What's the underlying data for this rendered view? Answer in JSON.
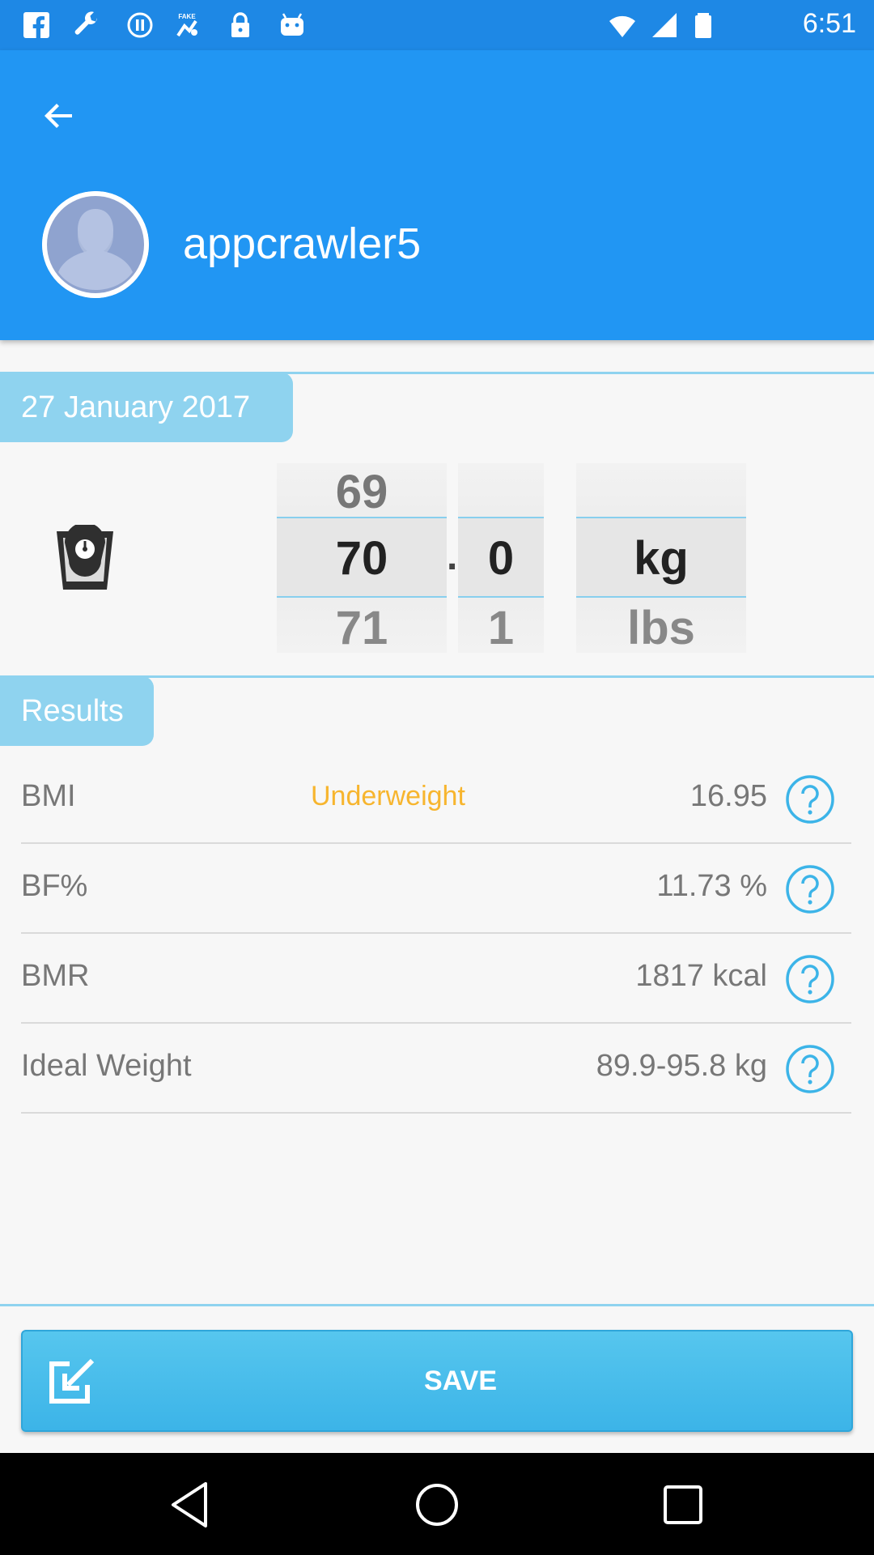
{
  "status_bar": {
    "time": "6:51",
    "left_icons": [
      "facebook-icon",
      "wrench-icon",
      "media-pause-icon",
      "fake-gps-icon",
      "lock-icon",
      "android-icon"
    ],
    "right_icons": [
      "wifi-icon",
      "signal-icon",
      "battery-icon"
    ]
  },
  "header": {
    "username": "appcrawler5",
    "background_color": "#2196f3"
  },
  "date_tab": {
    "label": "27 January 2017"
  },
  "weight_picker": {
    "integer": {
      "prev": "69",
      "current": "70",
      "next": "71"
    },
    "separator": ".",
    "decimal": {
      "prev": "",
      "current": "0",
      "next": "1"
    },
    "unit": {
      "prev": "",
      "current": "kg",
      "next": "lbs"
    }
  },
  "results": {
    "title": "Results",
    "rows": [
      {
        "label": "BMI",
        "status": "Underweight",
        "value": "16.95"
      },
      {
        "label": "BF%",
        "status": "",
        "value": "11.73 %"
      },
      {
        "label": "BMR",
        "status": "",
        "value": "1817 kcal"
      },
      {
        "label": "Ideal Weight",
        "status": "",
        "value": "89.9-95.8 kg"
      }
    ]
  },
  "save": {
    "label": "SAVE"
  },
  "colors": {
    "accent": "#8fd3ef",
    "warning": "#f7b52e",
    "help_icon": "#3cb4e8"
  }
}
